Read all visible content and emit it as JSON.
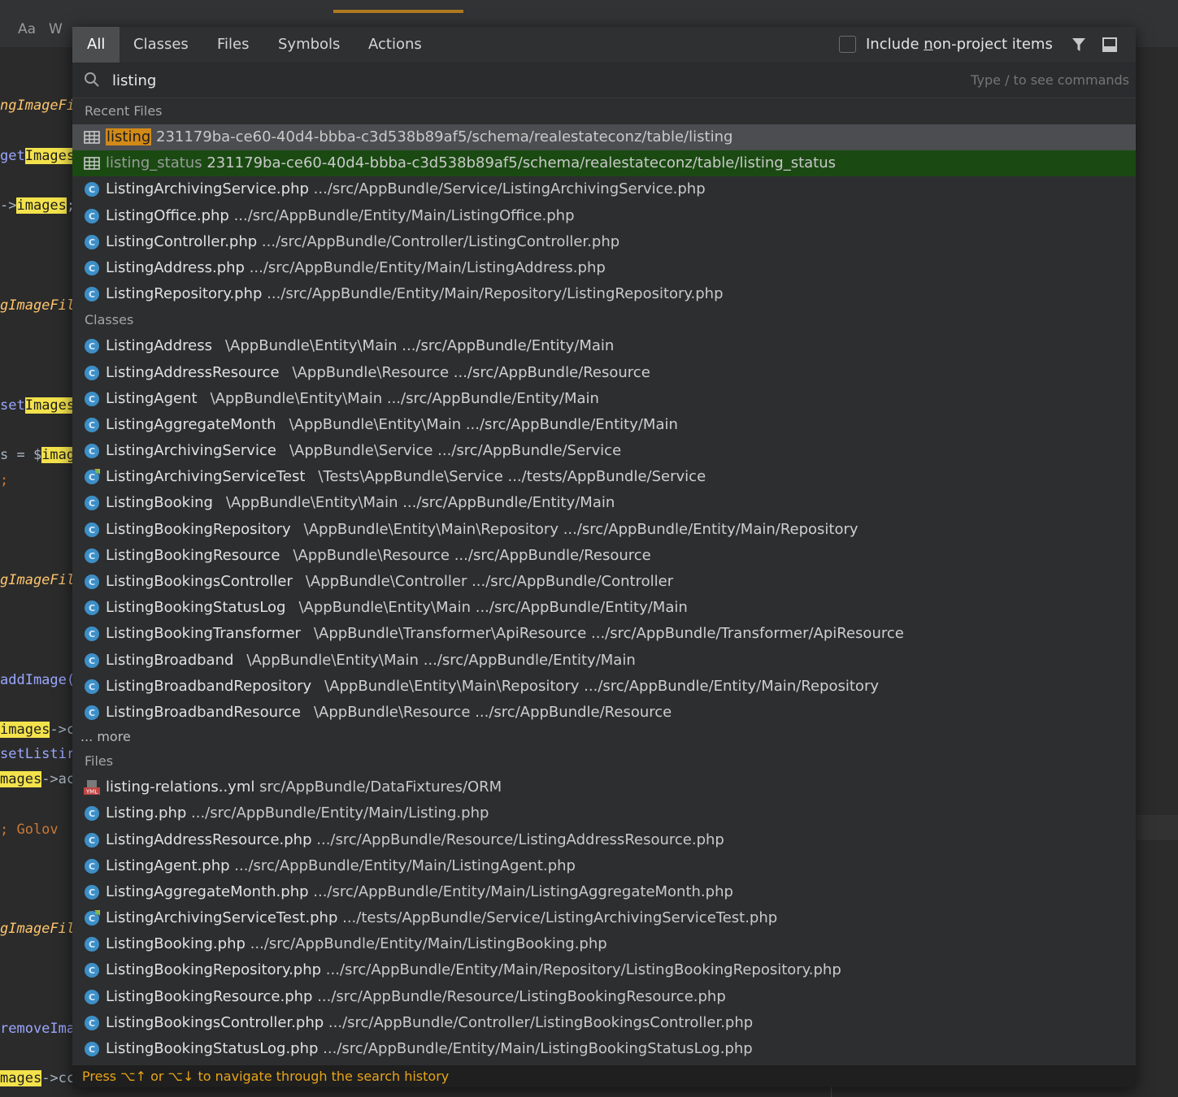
{
  "editor": {
    "lines": [
      {
        "text": "ngImageFi",
        "style": "italic"
      },
      {
        "pre": "get",
        "hl": "Images",
        "post": ""
      },
      {
        "pre": "->",
        "hl": "images",
        "post": ";"
      },
      {
        "text": "gImageFil",
        "style": "italic"
      },
      {
        "pre": "set",
        "hl": "Images",
        "post": ""
      },
      {
        "pre": "s = $",
        "hl": "imag",
        "post": ""
      },
      {
        "text": ";",
        "style": "plain"
      },
      {
        "text": "gImageFil",
        "style": "italic"
      },
      {
        "text": "addImage(",
        "style": "blue"
      },
      {
        "pre": "",
        "hl": "images",
        "post": "->c"
      },
      {
        "text": "setListir",
        "style": "blue"
      },
      {
        "pre": "",
        "hl": "mages",
        "post": "->ac"
      },
      {
        "text": ";   Golov",
        "style": "plain"
      },
      {
        "text": "gImageFil",
        "style": "italic"
      },
      {
        "text": "removeIma",
        "style": "blue"
      },
      {
        "pre": "",
        "hl": "mages",
        "post": "->cc"
      }
    ],
    "toolbar": [
      "Aa",
      "W"
    ]
  },
  "tabs": [
    "All",
    "Classes",
    "Files",
    "Symbols",
    "Actions"
  ],
  "active_tab": "All",
  "non_project": {
    "pre": "Include ",
    "u": "n",
    "post": "on-project items"
  },
  "search": {
    "value": "listing",
    "hint": "Type / to see commands"
  },
  "sections": {
    "recent": "Recent Files",
    "classes": "Classes",
    "files": "Files",
    "more": "... more"
  },
  "recent_files": [
    {
      "icon": "table-icon",
      "name": "listing",
      "path": "231179ba-ce60-40d4-bbba-c3d538b89af5/schema/realestateconz/table/listing",
      "state": "selected"
    },
    {
      "icon": "table-icon",
      "name": "listing_status",
      "path": "231179ba-ce60-40d4-bbba-c3d538b89af5/schema/realestateconz/table/listing_status",
      "state": "green"
    },
    {
      "icon": "class-icon",
      "name": "ListingArchivingService.php",
      "path": ".../src/AppBundle/Service/ListingArchivingService.php"
    },
    {
      "icon": "class-icon",
      "name": "ListingOffice.php",
      "path": ".../src/AppBundle/Entity/Main/ListingOffice.php"
    },
    {
      "icon": "class-icon",
      "name": "ListingController.php",
      "path": ".../src/AppBundle/Controller/ListingController.php"
    },
    {
      "icon": "class-icon",
      "name": "ListingAddress.php",
      "path": ".../src/AppBundle/Entity/Main/ListingAddress.php"
    },
    {
      "icon": "class-icon",
      "name": "ListingRepository.php",
      "path": ".../src/AppBundle/Entity/Main/Repository/ListingRepository.php"
    }
  ],
  "classes": [
    {
      "icon": "class-icon",
      "name": "ListingAddress",
      "ns": "\\AppBundle\\Entity\\Main .../src/AppBundle/Entity/Main"
    },
    {
      "icon": "class-icon",
      "name": "ListingAddressResource",
      "ns": "\\AppBundle\\Resource .../src/AppBundle/Resource"
    },
    {
      "icon": "class-icon",
      "name": "ListingAgent",
      "ns": "\\AppBundle\\Entity\\Main .../src/AppBundle/Entity/Main"
    },
    {
      "icon": "class-icon",
      "name": "ListingAggregateMonth",
      "ns": "\\AppBundle\\Entity\\Main .../src/AppBundle/Entity/Main"
    },
    {
      "icon": "class-icon",
      "name": "ListingArchivingService",
      "ns": "\\AppBundle\\Service .../src/AppBundle/Service"
    },
    {
      "icon": "test-class-icon",
      "name": "ListingArchivingServiceTest",
      "ns": "\\Tests\\AppBundle\\Service .../tests/AppBundle/Service"
    },
    {
      "icon": "class-icon",
      "name": "ListingBooking",
      "ns": "\\AppBundle\\Entity\\Main .../src/AppBundle/Entity/Main"
    },
    {
      "icon": "class-icon",
      "name": "ListingBookingRepository",
      "ns": "\\AppBundle\\Entity\\Main\\Repository .../src/AppBundle/Entity/Main/Repository"
    },
    {
      "icon": "class-icon",
      "name": "ListingBookingResource",
      "ns": "\\AppBundle\\Resource .../src/AppBundle/Resource"
    },
    {
      "icon": "class-icon",
      "name": "ListingBookingsController",
      "ns": "\\AppBundle\\Controller .../src/AppBundle/Controller"
    },
    {
      "icon": "class-icon",
      "name": "ListingBookingStatusLog",
      "ns": "\\AppBundle\\Entity\\Main .../src/AppBundle/Entity/Main"
    },
    {
      "icon": "class-icon",
      "name": "ListingBookingTransformer",
      "ns": "\\AppBundle\\Transformer\\ApiResource .../src/AppBundle/Transformer/ApiResource"
    },
    {
      "icon": "class-icon",
      "name": "ListingBroadband",
      "ns": "\\AppBundle\\Entity\\Main .../src/AppBundle/Entity/Main"
    },
    {
      "icon": "class-icon",
      "name": "ListingBroadbandRepository",
      "ns": "\\AppBundle\\Entity\\Main\\Repository .../src/AppBundle/Entity/Main/Repository"
    },
    {
      "icon": "class-icon",
      "name": "ListingBroadbandResource",
      "ns": "\\AppBundle\\Resource .../src/AppBundle/Resource"
    }
  ],
  "files": [
    {
      "icon": "yml-icon",
      "name": "listing-relations..yml",
      "path": "src/AppBundle/DataFixtures/ORM"
    },
    {
      "icon": "class-icon",
      "name": "Listing.php",
      "path": ".../src/AppBundle/Entity/Main/Listing.php"
    },
    {
      "icon": "class-icon",
      "name": "ListingAddressResource.php",
      "path": ".../src/AppBundle/Resource/ListingAddressResource.php"
    },
    {
      "icon": "class-icon",
      "name": "ListingAgent.php",
      "path": ".../src/AppBundle/Entity/Main/ListingAgent.php"
    },
    {
      "icon": "class-icon",
      "name": "ListingAggregateMonth.php",
      "path": ".../src/AppBundle/Entity/Main/ListingAggregateMonth.php"
    },
    {
      "icon": "test-class-icon",
      "name": "ListingArchivingServiceTest.php",
      "path": ".../tests/AppBundle/Service/ListingArchivingServiceTest.php"
    },
    {
      "icon": "class-icon",
      "name": "ListingBooking.php",
      "path": ".../src/AppBundle/Entity/Main/ListingBooking.php"
    },
    {
      "icon": "class-icon",
      "name": "ListingBookingRepository.php",
      "path": ".../src/AppBundle/Entity/Main/Repository/ListingBookingRepository.php"
    },
    {
      "icon": "class-icon",
      "name": "ListingBookingResource.php",
      "path": ".../src/AppBundle/Resource/ListingBookingResource.php"
    },
    {
      "icon": "class-icon",
      "name": "ListingBookingsController.php",
      "path": ".../src/AppBundle/Controller/ListingBookingsController.php"
    },
    {
      "icon": "class-icon",
      "name": "ListingBookingStatusLog.php",
      "path": ".../src/AppBundle/Entity/Main/ListingBookingStatusLog.php"
    }
  ],
  "footer": "Press ⌥↑ or ⌥↓ to navigate through the search history",
  "colors": {
    "accent": "#d28a17",
    "selected_bg": "#4b4d50",
    "green_bg": "#1a4a12",
    "class_icon": "#3d8fc7",
    "footer_text": "#e9a417"
  }
}
